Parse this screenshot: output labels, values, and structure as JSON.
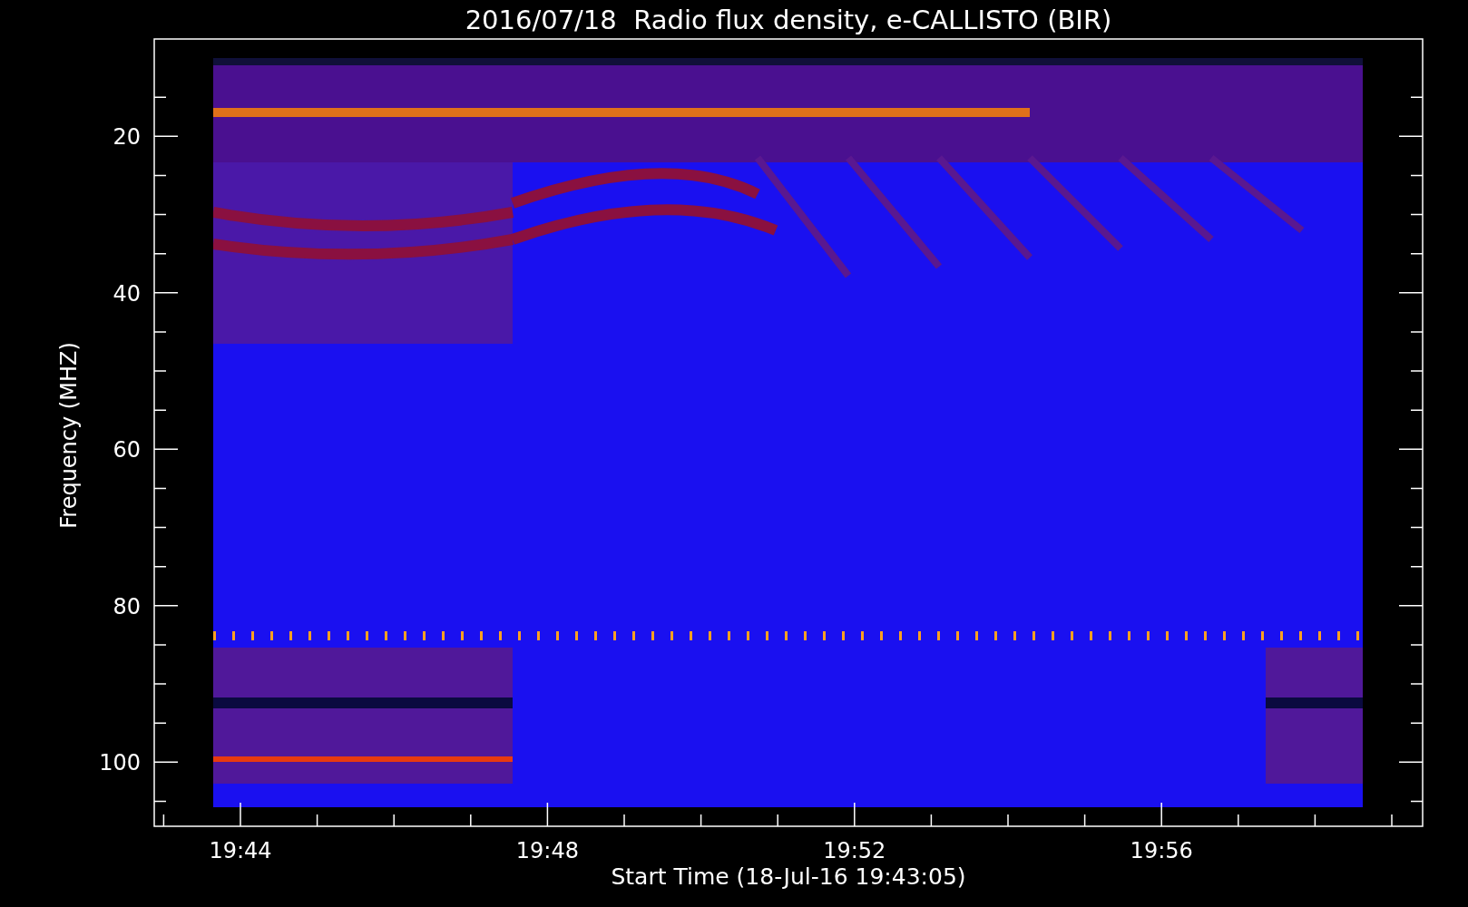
{
  "plot": {
    "title": "2016/07/18  Radio flux density, e-CALLISTO (BIR)",
    "ylabel": "Frequency (MHZ)",
    "xlabel": "Start Time (18-Jul-16 19:43:05)",
    "ytick_labels": [
      "20",
      "40",
      "60",
      "80",
      "100"
    ],
    "xtick_labels": [
      "19:44",
      "19:48",
      "19:52",
      "19:56"
    ]
  }
}
